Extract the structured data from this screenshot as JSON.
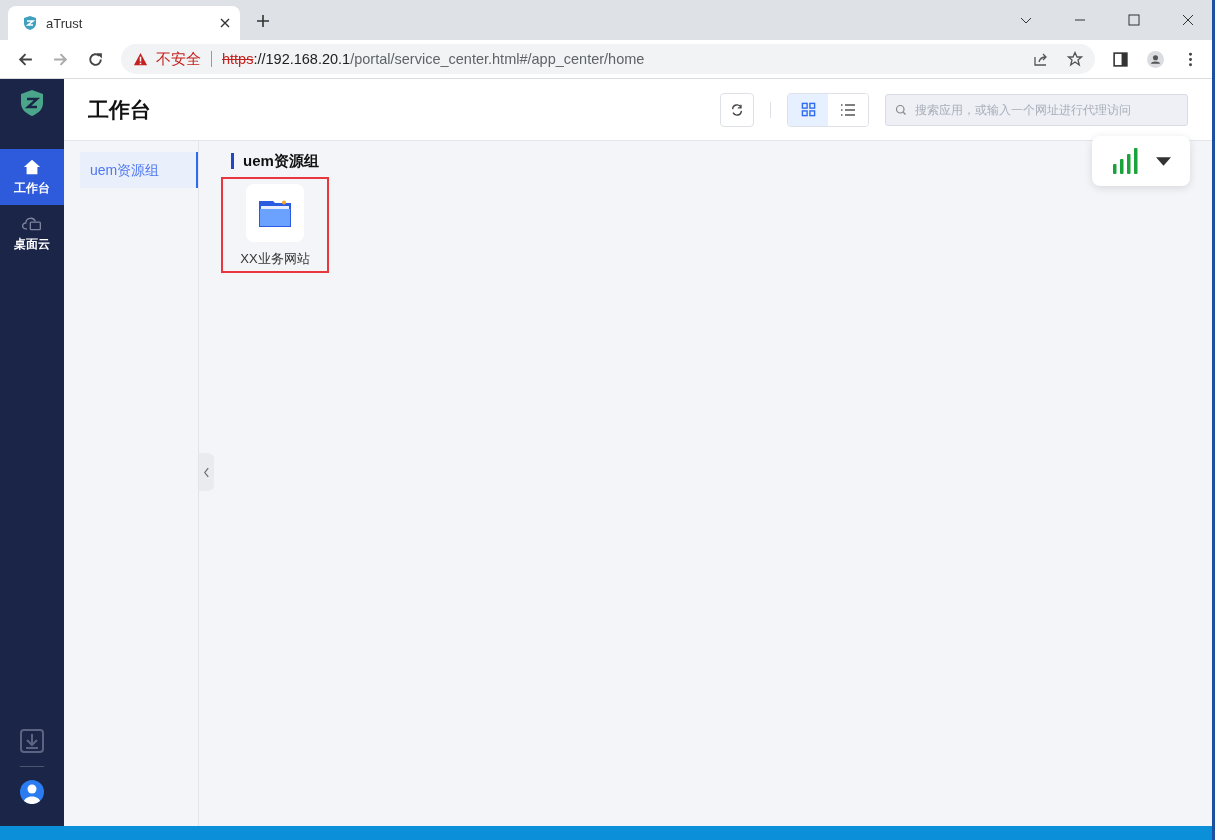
{
  "browser": {
    "tab_title": "aTrust",
    "security_label": "不安全",
    "url_scheme": "https",
    "url_host": "://192.168.20.1",
    "url_path": "/portal/service_center.html#/app_center/home"
  },
  "nav": {
    "items": [
      {
        "kind": "home",
        "label": "工作台",
        "selected": true
      },
      {
        "kind": "cloud",
        "label": "桌面云",
        "selected": false
      }
    ]
  },
  "header": {
    "title": "工作台",
    "views": [
      {
        "kind": "grid",
        "selected": true
      },
      {
        "kind": "list",
        "selected": false
      }
    ],
    "search": {
      "placeholder": "搜索应用，或输入一个网址进行代理访问"
    }
  },
  "groups": [
    {
      "label": "uem资源组",
      "selected": true
    }
  ],
  "sections": [
    {
      "title": "uem资源组",
      "apps": [
        {
          "name": "XX业务网站",
          "highlighted": true
        }
      ]
    }
  ]
}
